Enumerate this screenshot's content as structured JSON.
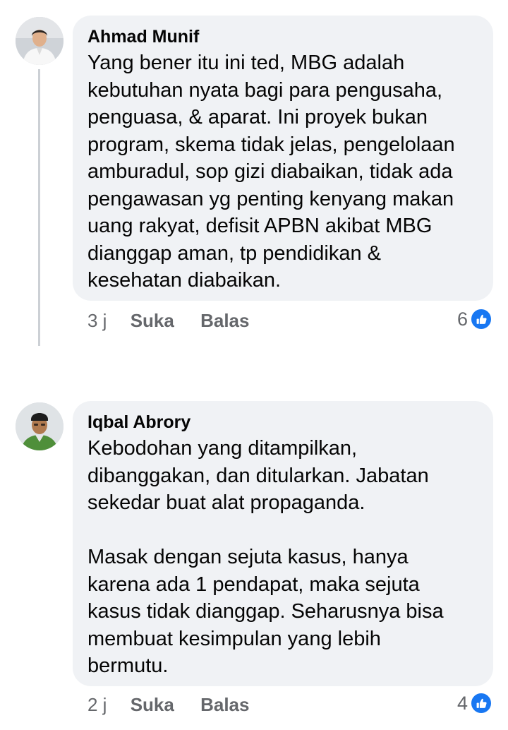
{
  "comments": [
    {
      "author": "Ahmad Munif",
      "text": "Yang bener itu ini ted, MBG adalah\nkebutuhan nyata bagi para pengusaha,\npenguasa, & aparat. Ini proyek bukan\nprogram, skema tidak jelas, pengelolaan\namburadul, sop gizi diabaikan, tidak ada\npengawasan yg penting kenyang makan\nuang rakyat, defisit APBN akibat MBG\ndianggap aman, tp pendidikan &\nkesehatan diabaikan.",
      "time": "3 j",
      "like_label": "Suka",
      "reply_label": "Balas",
      "reaction_count": "6",
      "reaction_icon": "thumbs-up-icon",
      "reaction_color": "#1877f2"
    },
    {
      "author": "Iqbal Abrory",
      "text": "Kebodohan yang ditampilkan,\ndibanggakan, dan ditularkan. Jabatan\nsekedar buat alat propaganda.\n\nMasak dengan sejuta kasus, hanya\nkarena ada 1 pendapat, maka sejuta\nkasus tidak dianggap. Seharusnya bisa\nmembuat kesimpulan yang lebih\nbermutu.",
      "time": "2 j",
      "like_label": "Suka",
      "reply_label": "Balas",
      "reaction_count": "4",
      "reaction_icon": "thumbs-up-icon",
      "reaction_color": "#1877f2"
    }
  ]
}
